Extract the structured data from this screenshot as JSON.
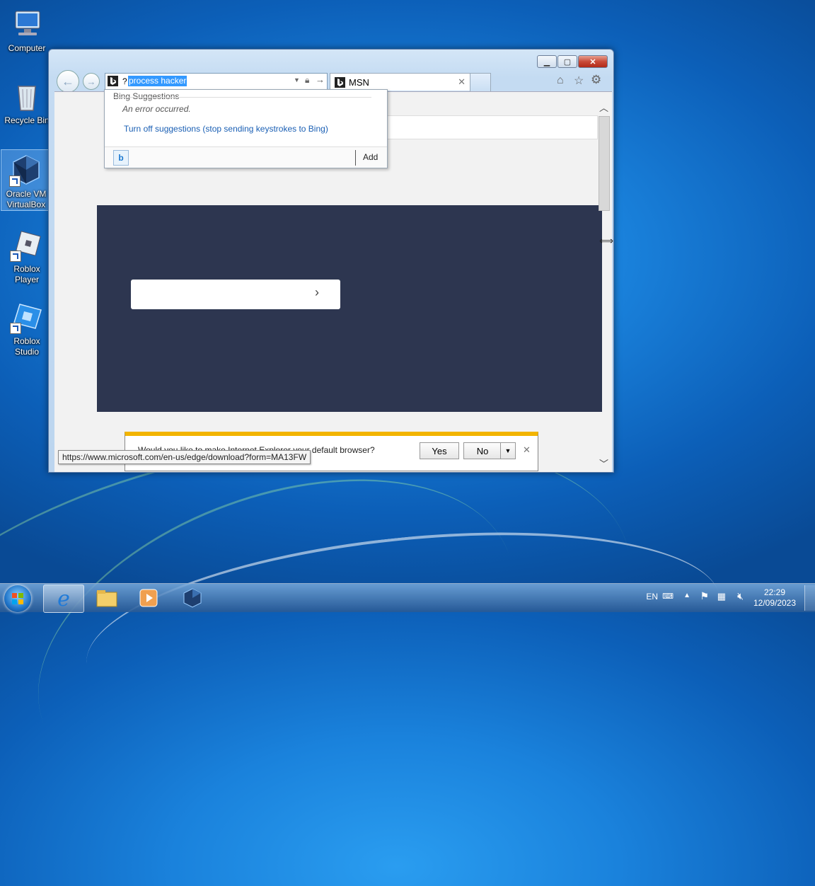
{
  "desktop": {
    "icons": [
      {
        "label": "Computer"
      },
      {
        "label": "Recycle Bin"
      },
      {
        "label": "Oracle VM VirtualBox"
      },
      {
        "label": "Roblox Player"
      },
      {
        "label": "Roblox Studio"
      }
    ]
  },
  "browser": {
    "address": {
      "prefix": "?",
      "value": "process hacker"
    },
    "tab": {
      "title": "MSN"
    },
    "suggestions": {
      "header": "Bing Suggestions",
      "error": "An error occurred.",
      "link": "Turn off suggestions (stop sending keystrokes to Bing)",
      "add_label": "Add"
    },
    "notification": {
      "text": "Would you like to make Internet Explorer your default browser?",
      "yes_label": "Yes",
      "no_label": "No"
    },
    "status_url": "https://www.microsoft.com/en-us/edge/download?form=MA13FW"
  },
  "taskbar": {
    "language": "EN",
    "time": "22:29",
    "date": "12/09/2023"
  },
  "colors": {
    "panel": "#2d3650",
    "notification_bar": "#f2b400",
    "link": "#1a5fb4"
  }
}
